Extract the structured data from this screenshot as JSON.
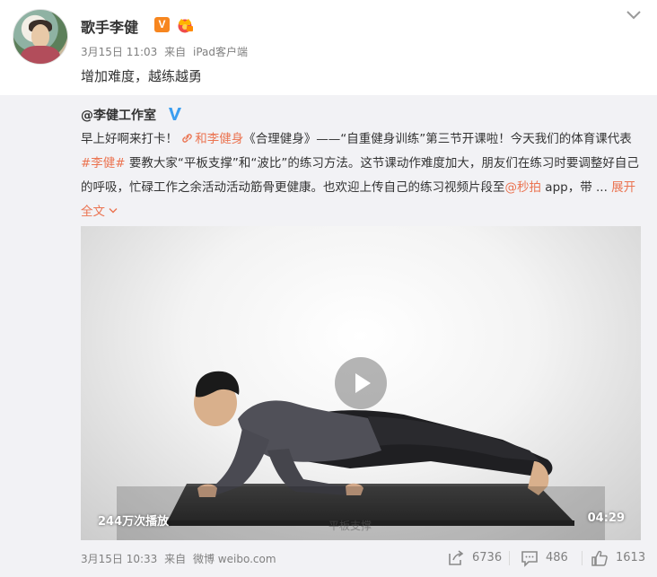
{
  "post": {
    "author": "歌手李健",
    "verified_badge": "V",
    "date": "3月15日 11:03",
    "source_prefix": "来自",
    "source": "iPad客户端",
    "text": "增加难度，越练越勇"
  },
  "repost": {
    "author": "@李健工作室",
    "text_1": "早上好啊来打卡！",
    "link_person": "和李健身",
    "text_2": "《合理健身》——“自重健身训练”第三节开课啦！今天我们的体育课代表",
    "hashtag": "#李健#",
    "text_3": " 要教大家“平板支撑”和“波比”的练习方法。这节课动作难度加大，朋友们在练习时要调整好自己的呼吸，忙碌工作之余活动活动筋骨更健康。也欢迎上传自己的练习视频片段至",
    "mention": "@秒拍",
    "text_4": " app，带 ... ",
    "expand_label": "展开全文",
    "video": {
      "views": "244万次播放",
      "duration": "04:29",
      "subtitle": "平板支撑"
    },
    "date": "3月15日 10:33",
    "source_prefix": "来自",
    "source": "微博 weibo.com",
    "actions": {
      "repost_count": "6736",
      "comment_count": "486",
      "like_count": "1613"
    }
  },
  "colors": {
    "link": "#eb7350",
    "badge_orange": "#f7861f",
    "verified_blue": "#3b9ef0",
    "repost_bg": "#f2f2f5",
    "meta_gray": "#808080"
  },
  "icons": [
    "chevron-down-icon",
    "crown-icon",
    "verified-blue-icon",
    "link-icon",
    "play-icon",
    "repost-icon",
    "comment-icon",
    "like-icon"
  ]
}
